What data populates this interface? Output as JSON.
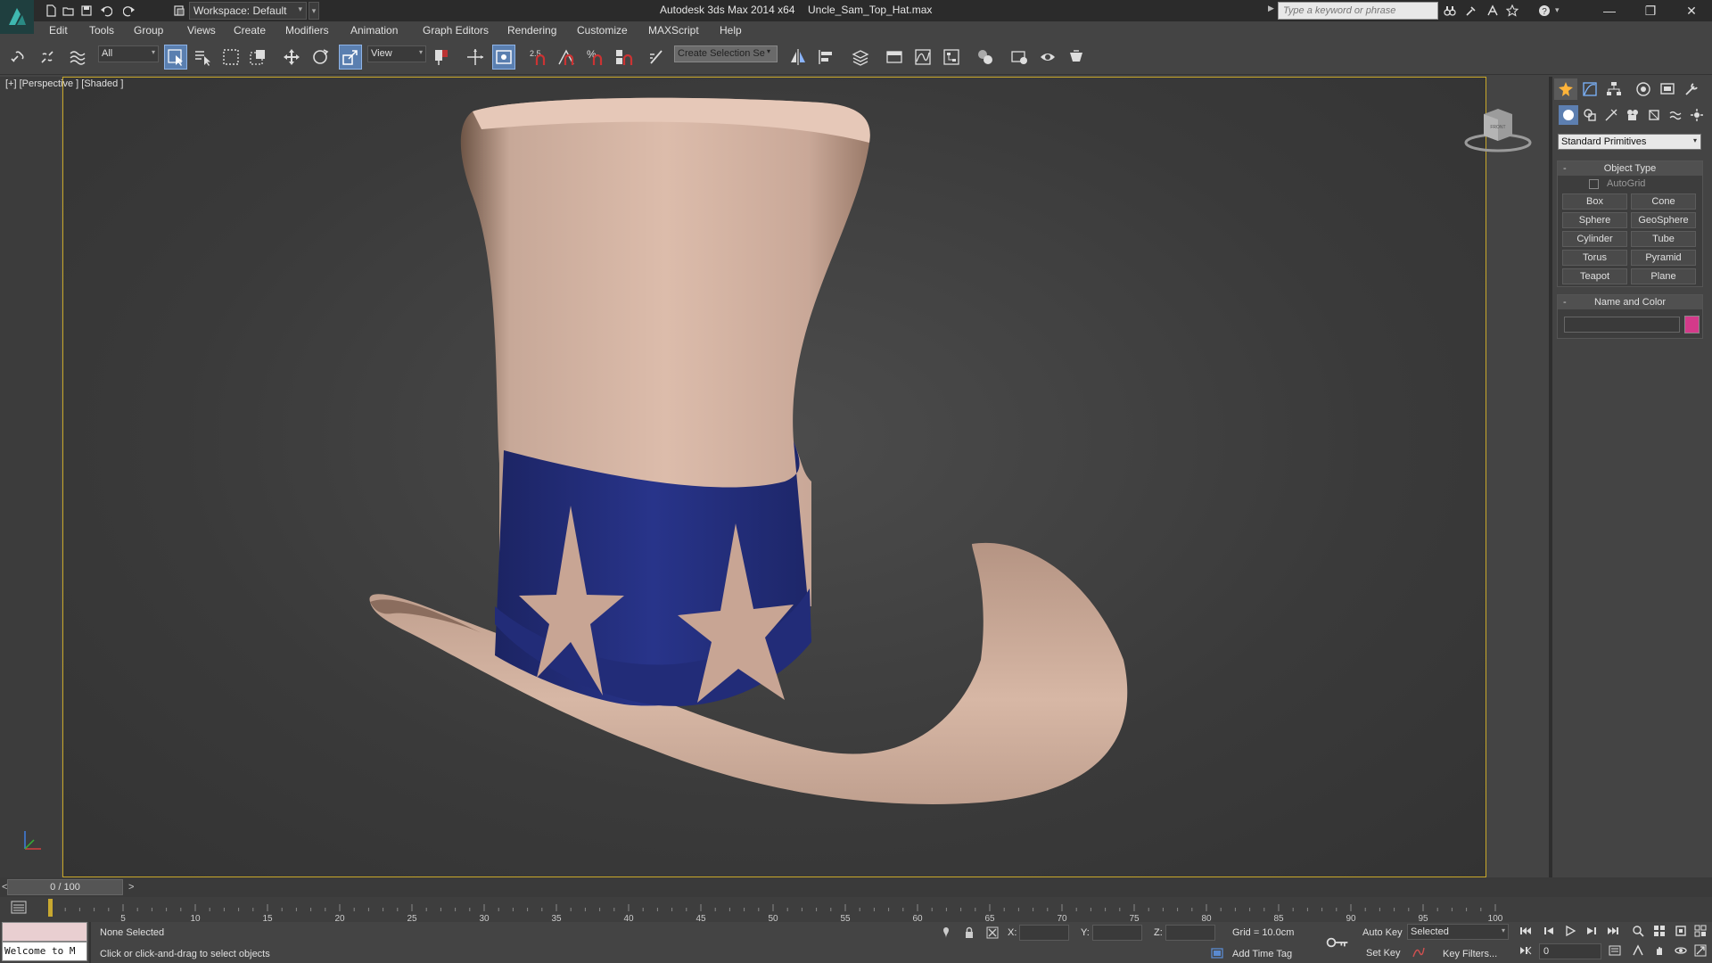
{
  "window": {
    "app_title": "Autodesk 3ds Max  2014 x64",
    "file_title": "Uncle_Sam_Top_Hat.max",
    "workspace_label": "Workspace: Default",
    "search_placeholder": "Type a keyword or phrase"
  },
  "menu": [
    "Edit",
    "Tools",
    "Group",
    "Views",
    "Create",
    "Modifiers",
    "Animation",
    "Graph Editors",
    "Rendering",
    "Customize",
    "MAXScript",
    "Help"
  ],
  "toolbar": {
    "selection_filter": "All",
    "reference_coord": "View",
    "snap_value": "2.5",
    "create_selection_set": "Create Selection Se"
  },
  "viewport": {
    "label": "[+] [Perspective ] [Shaded ]",
    "viewcube_face": "FRONT"
  },
  "command_panel": {
    "category": "Standard Primitives",
    "object_type_title": "Object Type",
    "autogrid_label": "AutoGrid",
    "primitives": [
      "Box",
      "Cone",
      "Sphere",
      "GeoSphere",
      "Cylinder",
      "Tube",
      "Torus",
      "Pyramid",
      "Teapot",
      "Plane"
    ],
    "name_color_title": "Name and Color",
    "object_color": "#d43a8a"
  },
  "timeline": {
    "frame_display": "0 / 100",
    "prev_label": "<",
    "next_label": ">",
    "ticks": [
      "5",
      "10",
      "15",
      "20",
      "25",
      "30",
      "35",
      "40",
      "45",
      "50",
      "55",
      "60",
      "65",
      "70",
      "75",
      "80",
      "85",
      "90",
      "95",
      "100"
    ]
  },
  "status": {
    "welcome": "Welcome to M",
    "selection": "None Selected",
    "prompt": "Click or click-and-drag to select objects",
    "x_label": "X:",
    "y_label": "Y:",
    "z_label": "Z:",
    "grid": "Grid = 10.0cm",
    "add_time_tag": "Add Time Tag",
    "auto_key": "Auto Key",
    "set_key": "Set Key",
    "key_mode": "Selected",
    "key_filters": "Key Filters...",
    "current_frame": "0"
  }
}
